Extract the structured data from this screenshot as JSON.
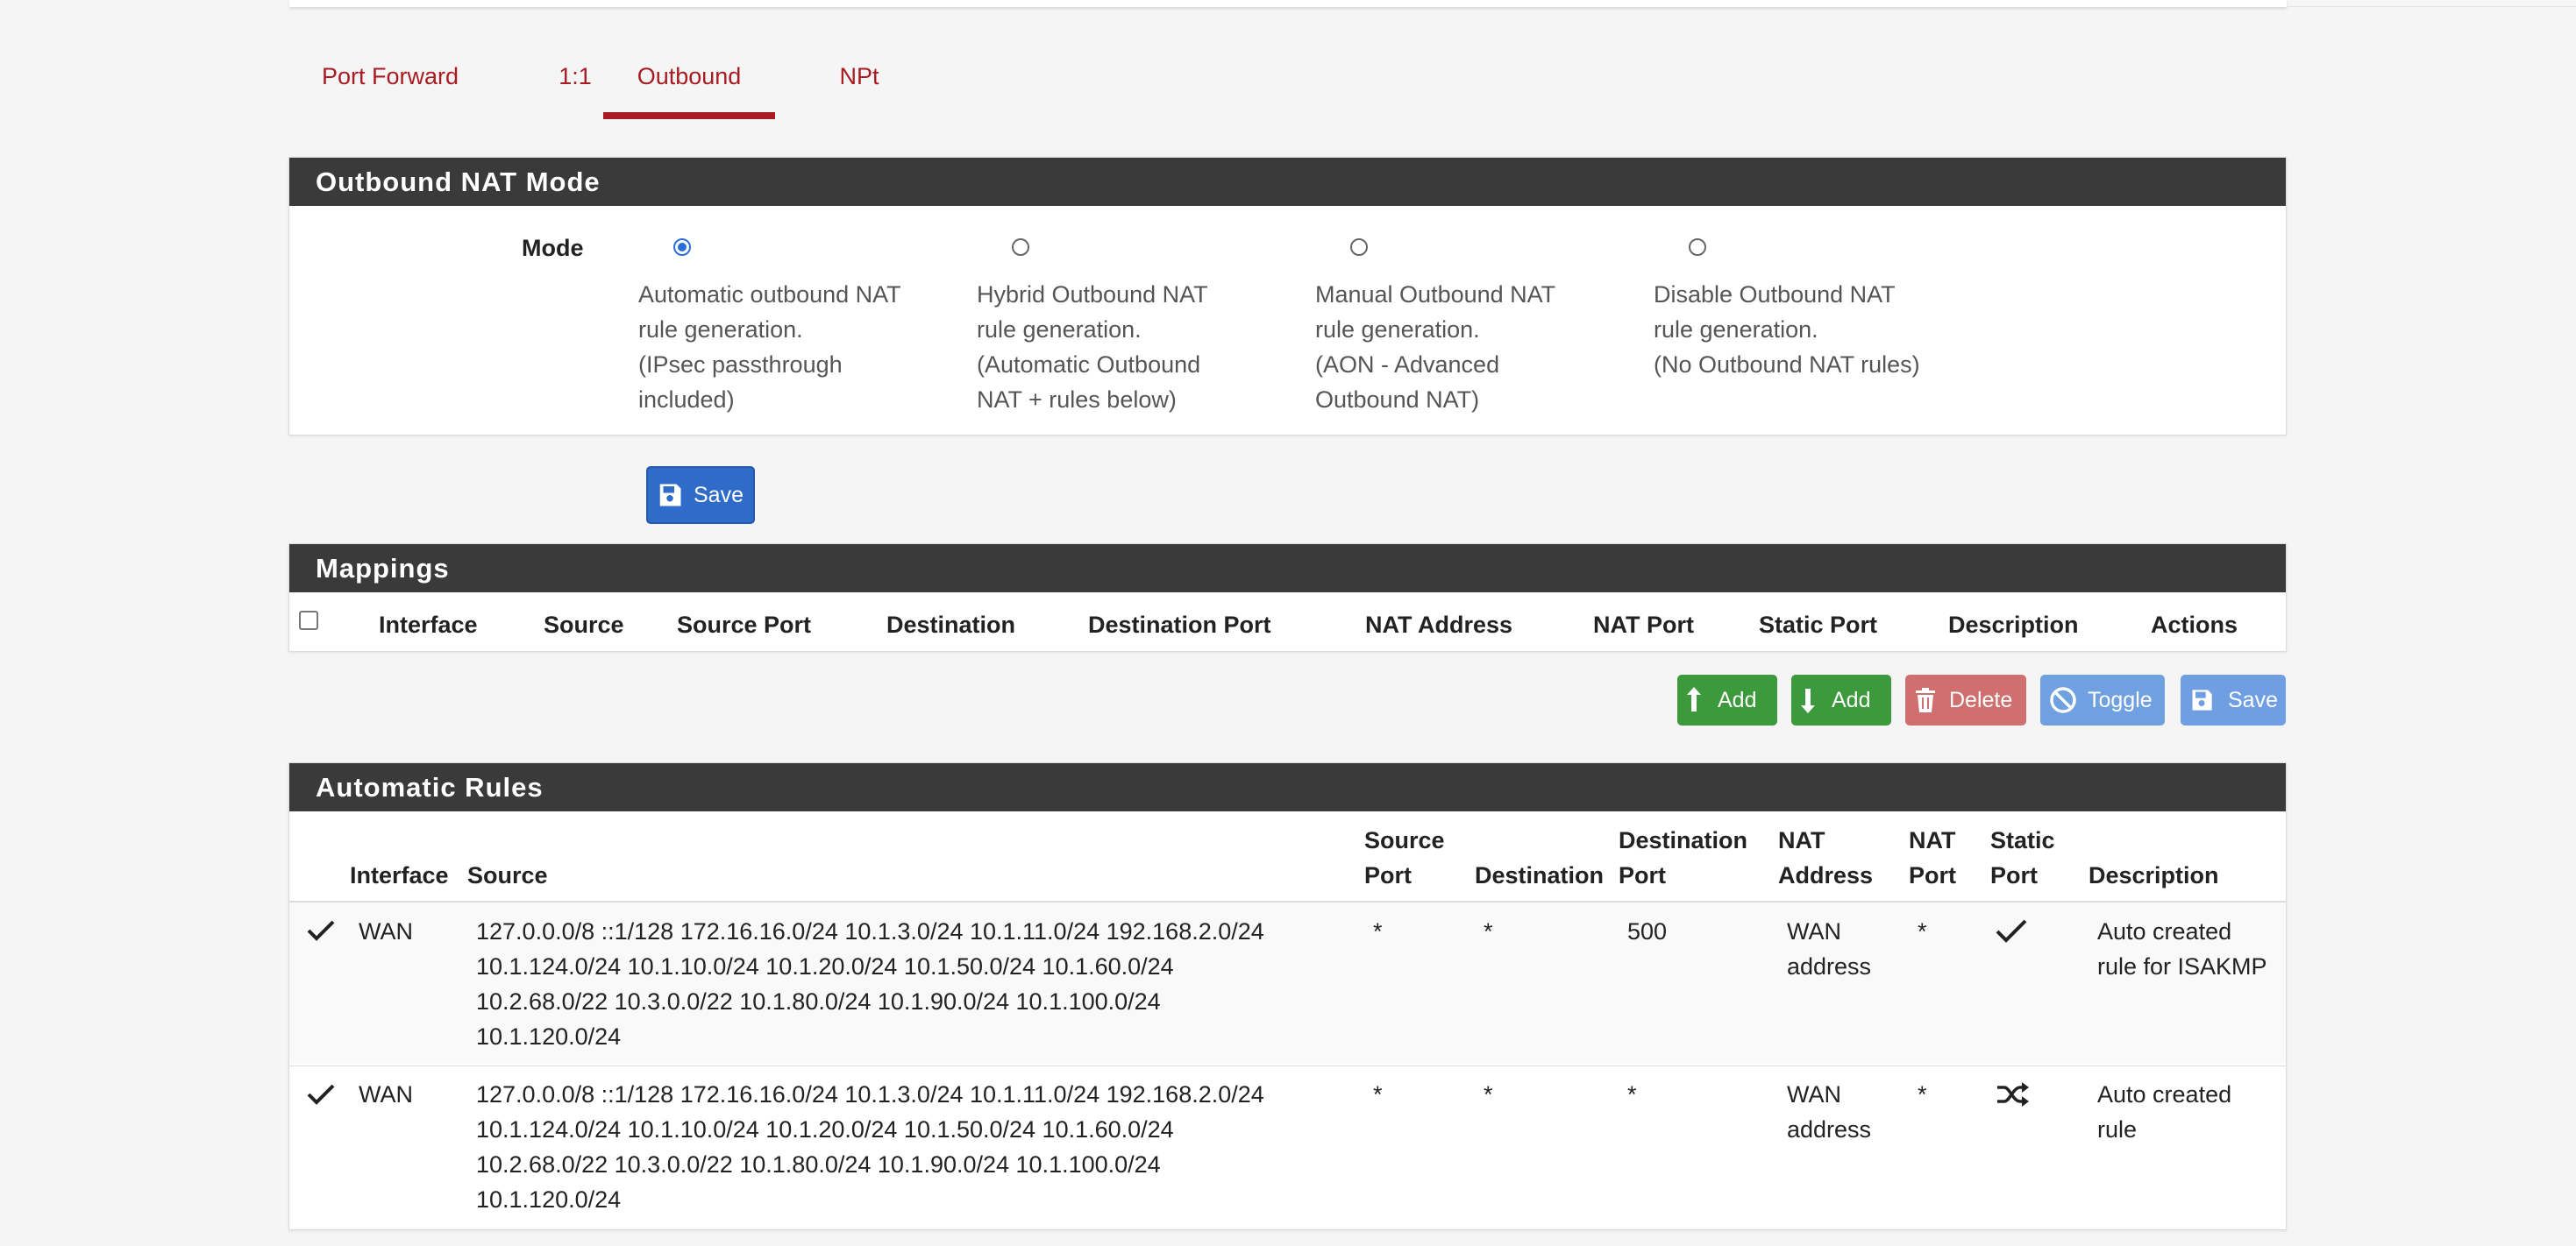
{
  "tabs": [
    {
      "label": "Port Forward",
      "active": false
    },
    {
      "label": "1:1",
      "active": false
    },
    {
      "label": "Outbound",
      "active": true
    },
    {
      "label": "NPt",
      "active": false
    }
  ],
  "colors": {
    "accent": "#a91b22",
    "panel_header": "#3a3a3a",
    "primary": "#2f6bc9",
    "success": "#3c9a3c",
    "danger": "#cf6f6f",
    "info": "#6fa0df"
  },
  "mode_panel": {
    "title": "Outbound NAT Mode",
    "mode_label": "Mode",
    "options": [
      {
        "lines": [
          "Automatic outbound NAT",
          "rule generation.",
          "(IPsec passthrough",
          "included)"
        ],
        "checked": true
      },
      {
        "lines": [
          "Hybrid Outbound NAT",
          "rule generation.",
          "(Automatic Outbound",
          "NAT + rules below)"
        ],
        "checked": false
      },
      {
        "lines": [
          "Manual Outbound NAT",
          "rule generation.",
          "(AON - Advanced",
          "Outbound NAT)"
        ],
        "checked": false
      },
      {
        "lines": [
          "Disable Outbound NAT",
          "rule generation.",
          "(No Outbound NAT rules)"
        ],
        "checked": false
      }
    ],
    "save_label": "Save",
    "save_icon": "floppy-disk-icon"
  },
  "mappings": {
    "title": "Mappings",
    "columns": [
      "Interface",
      "Source",
      "Source Port",
      "Destination",
      "Destination Port",
      "NAT Address",
      "NAT Port",
      "Static Port",
      "Description",
      "Actions"
    ],
    "buttons": [
      {
        "label": "Add",
        "icon": "arrow-up-add-icon"
      },
      {
        "label": "Add",
        "icon": "arrow-down-add-icon"
      },
      {
        "label": "Delete",
        "icon": "trash-icon"
      },
      {
        "label": "Toggle",
        "icon": "ban-icon"
      },
      {
        "label": "Save",
        "icon": "floppy-disk-icon"
      }
    ]
  },
  "automatic_rules": {
    "title": "Automatic Rules",
    "columns": {
      "interface": "Interface",
      "source": "Source",
      "source_port": [
        "Source",
        "Port"
      ],
      "destination": "Destination",
      "destination_port": [
        "Destination",
        "Port"
      ],
      "nat_address": [
        "NAT",
        "Address"
      ],
      "nat_port": [
        "NAT",
        "Port"
      ],
      "static_port": [
        "Static",
        "Port"
      ],
      "description": "Description"
    },
    "rows": [
      {
        "enabled_icon": "check-icon",
        "interface": "WAN",
        "source": [
          "127.0.0.0/8 ::1/128 172.16.16.0/24 10.1.3.0/24 10.1.11.0/24 192.168.2.0/24",
          "10.1.124.0/24 10.1.10.0/24 10.1.20.0/24 10.1.50.0/24 10.1.60.0/24",
          "10.2.68.0/22 10.3.0.0/22 10.1.80.0/24 10.1.90.0/24 10.1.100.0/24",
          "10.1.120.0/24"
        ],
        "source_port": "*",
        "destination": "*",
        "destination_port": "500",
        "nat_address": [
          "WAN",
          "address"
        ],
        "nat_port": "*",
        "static_port_icon": "check-icon",
        "description": [
          "Auto created",
          "rule for ISAKMP"
        ]
      },
      {
        "enabled_icon": "check-icon",
        "interface": "WAN",
        "source": [
          "127.0.0.0/8 ::1/128 172.16.16.0/24 10.1.3.0/24 10.1.11.0/24 192.168.2.0/24",
          "10.1.124.0/24 10.1.10.0/24 10.1.20.0/24 10.1.50.0/24 10.1.60.0/24",
          "10.2.68.0/22 10.3.0.0/22 10.1.80.0/24 10.1.90.0/24 10.1.100.0/24",
          "10.1.120.0/24"
        ],
        "source_port": "*",
        "destination": "*",
        "destination_port": "*",
        "nat_address": [
          "WAN",
          "address"
        ],
        "nat_port": "*",
        "static_port_icon": "shuffle-icon",
        "description": [
          "Auto created",
          "rule"
        ]
      }
    ]
  }
}
